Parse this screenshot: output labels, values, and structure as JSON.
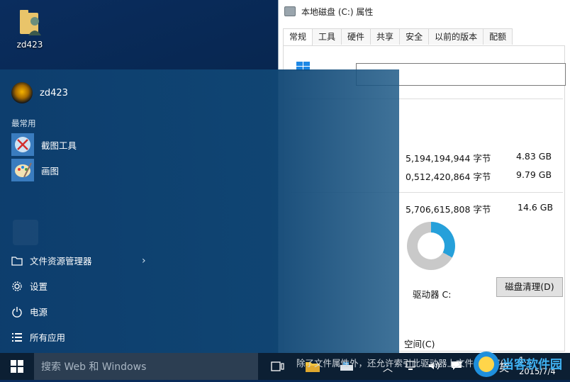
{
  "desktop": {
    "icon_label": "zd423"
  },
  "properties_window": {
    "title": "本地磁盘 (C:) 属性",
    "tabs": [
      "常规",
      "工具",
      "硬件",
      "共享",
      "安全",
      "以前的版本",
      "配额"
    ],
    "active_tab": "常规",
    "used_bytes": "5,194,194,944 字节",
    "used_gb": "4.83 GB",
    "free_bytes": "0,512,420,864 字节",
    "free_gb": "9.79 GB",
    "capacity_bytes": "5,706,615,808 字节",
    "capacity_gb": "14.6 GB",
    "drive_label": "驱动器 C:",
    "cleanup_button": "磁盘清理(D)",
    "compress_option_fragment": "空间(C)",
    "index_option_fragment": "除了文件属性外，还允许索引此驱动器上文件的内容(I)",
    "used_fraction": 0.33,
    "colors": {
      "used": "#26a0da",
      "free": "#c9c9c9"
    }
  },
  "start_menu": {
    "user_name": "zd423",
    "most_used_label": "最常用",
    "apps": [
      {
        "label": "截图工具",
        "icon": "snipping-tool-icon"
      },
      {
        "label": "画图",
        "icon": "paint-icon"
      }
    ],
    "bottom_items": [
      {
        "label": "文件资源管理器",
        "icon": "folder-icon"
      },
      {
        "label": "设置",
        "icon": "gear-icon"
      },
      {
        "label": "电源",
        "icon": "power-icon"
      },
      {
        "label": "所有应用",
        "icon": "list-icon"
      }
    ]
  },
  "taskbar": {
    "search_placeholder": "搜索 Web 和 Windows",
    "ime_label": "英",
    "time_partial": "1...",
    "date": "2015/7/4"
  },
  "watermark_text": "当客软件园"
}
